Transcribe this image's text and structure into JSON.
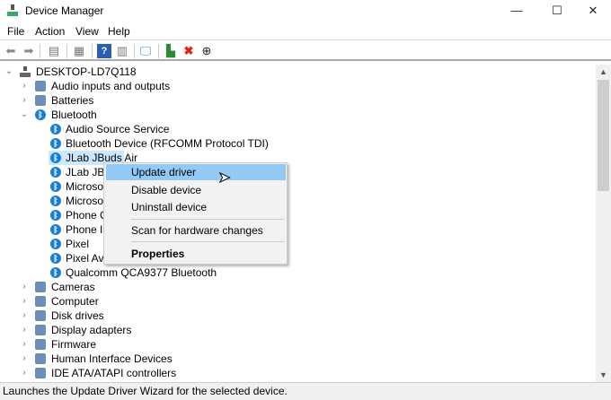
{
  "window": {
    "title": "Device Manager",
    "controls": {
      "minimize": "—",
      "maximize": "☐",
      "close": "✕"
    }
  },
  "menu": [
    "File",
    "Action",
    "View",
    "Help"
  ],
  "toolbar": [
    "back-icon",
    "forward-icon",
    "show-hide-console-tree-icon",
    "properties-icon",
    "help-icon",
    "action-pane-icon",
    "scan-hardware-icon",
    "update-driver-icon",
    "uninstall-icon",
    "disable-icon"
  ],
  "tree": {
    "root": "DESKTOP-LD7Q118",
    "categories_before": [
      "Audio inputs and outputs",
      "Batteries"
    ],
    "bluetooth": {
      "label": "Bluetooth",
      "children": [
        "Audio Source Service",
        "Bluetooth Device (RFCOMM Protocol TDI)",
        "JLab JBuds Air",
        "JLab JBu",
        "Microsof",
        "Microsof",
        "Phone C",
        "Phone In",
        "Pixel",
        "Pixel Av",
        "Qualcomm QCA9377 Bluetooth"
      ]
    },
    "categories_after": [
      "Cameras",
      "Computer",
      "Disk drives",
      "Display adapters",
      "Firmware",
      "Human Interface Devices",
      "IDE ATA/ATAPI controllers"
    ]
  },
  "context_menu": {
    "update": "Update driver",
    "disable": "Disable device",
    "uninstall": "Uninstall device",
    "scan": "Scan for hardware changes",
    "properties": "Properties"
  },
  "status": "Launches the Update Driver Wizard for the selected device.",
  "colors": {
    "selection": "#cce8ff",
    "menu_highlight": "#91c9f7",
    "bluetooth": "#1a7fd4"
  }
}
